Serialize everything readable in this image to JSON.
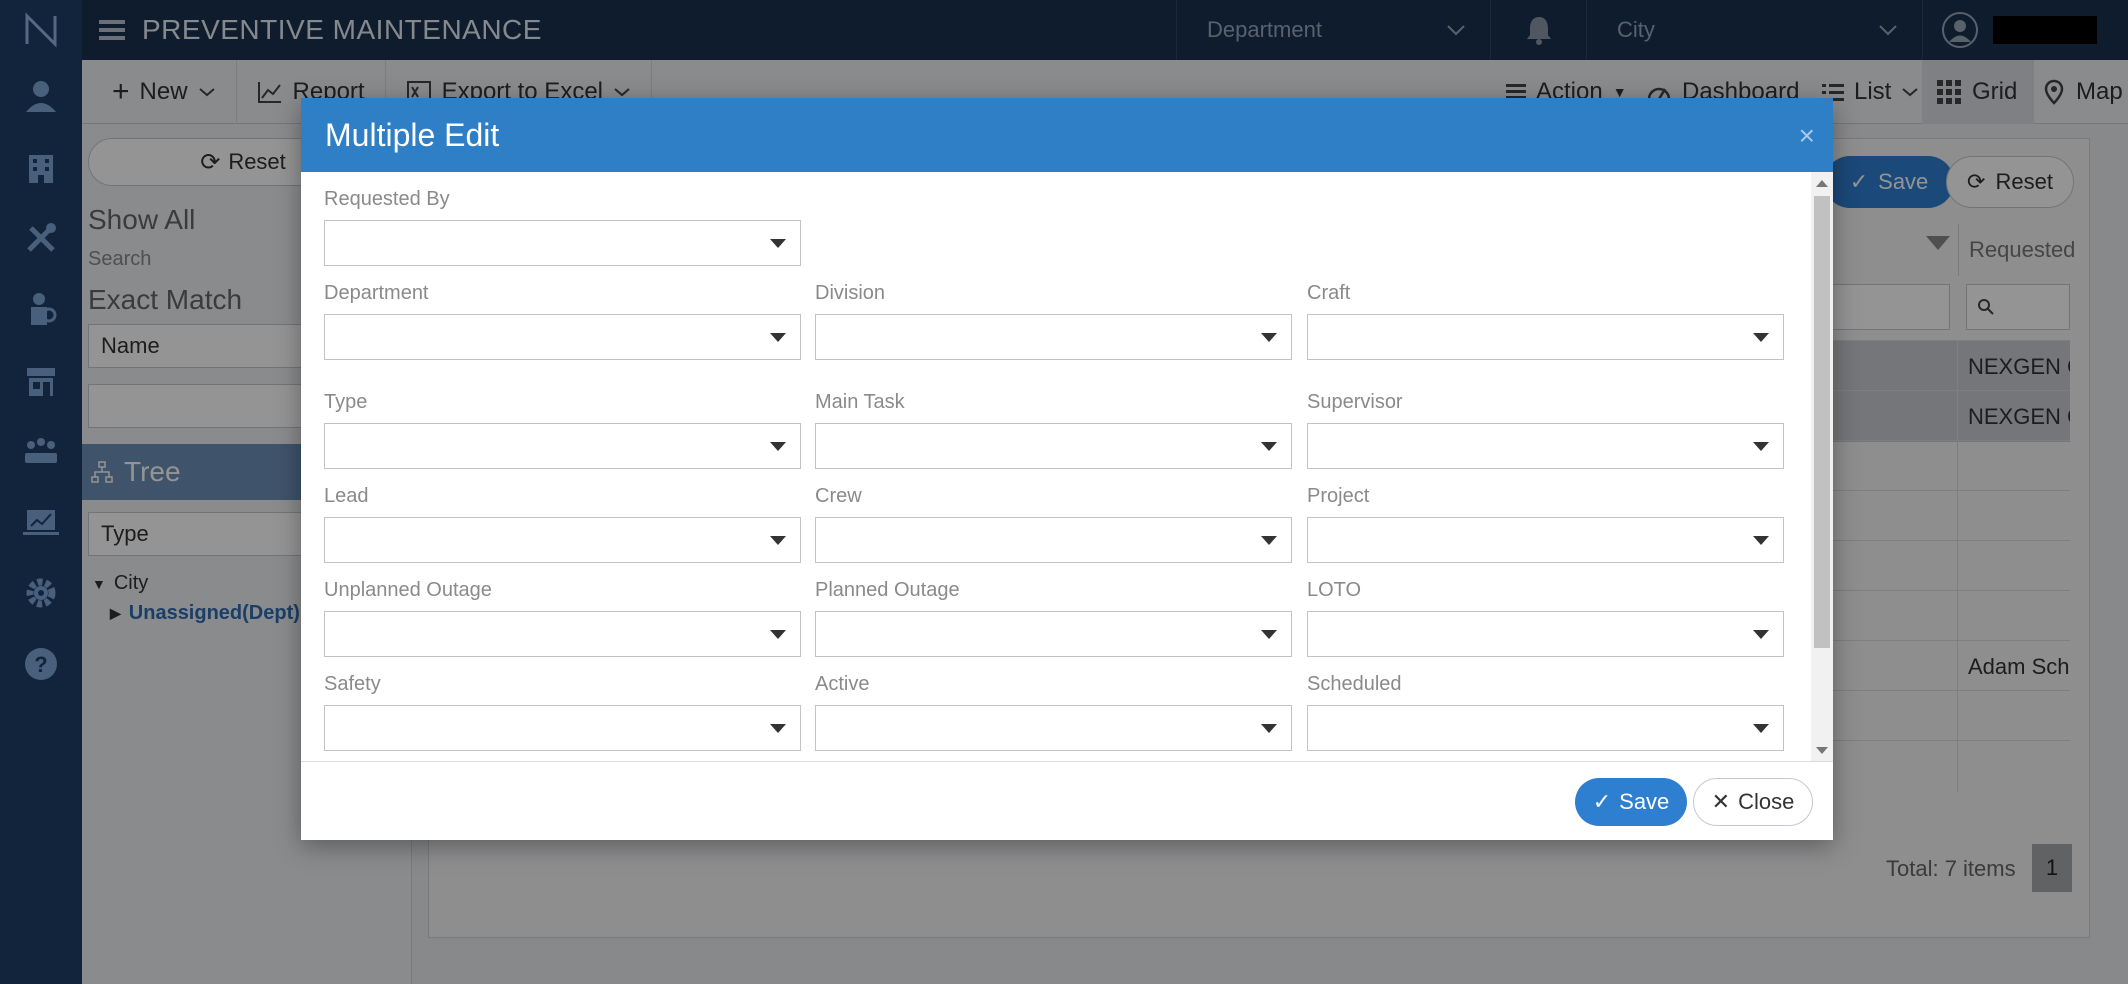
{
  "header": {
    "title": "PREVENTIVE MAINTENANCE",
    "department_placeholder": "Department",
    "city_placeholder": "City"
  },
  "toolbar": {
    "new_label": "New",
    "report_label": "Report",
    "export_label": "Export to Excel",
    "action_label": "Action",
    "dashboard_label": "Dashboard",
    "list_label": "List",
    "grid_label": "Grid",
    "map_label": "Map"
  },
  "filter_panel": {
    "reset_label": "Reset",
    "show_all": "Show All",
    "search_label": "Search",
    "exact_match": "Exact Match",
    "search_field": "Name",
    "tree_label": "Tree",
    "tree_field": "Type",
    "tree_root": "City",
    "tree_child": "Unassigned(Dept)"
  },
  "grid": {
    "save_label": "Save",
    "reset_label": "Reset",
    "column_header": "Requested",
    "rows": [
      "NEXGEN CS",
      "NEXGEN CS",
      "",
      "",
      "",
      "",
      "Adam Schr",
      "",
      ""
    ],
    "total": "Total: 7 items",
    "page": "1"
  },
  "modal": {
    "title": "Multiple Edit",
    "close_symbol": "×",
    "fields": {
      "requested_by": "Requested By",
      "department": "Department",
      "division": "Division",
      "craft": "Craft",
      "type": "Type",
      "main_task": "Main Task",
      "supervisor": "Supervisor",
      "lead": "Lead",
      "crew": "Crew",
      "project": "Project",
      "unplanned_outage": "Unplanned Outage",
      "planned_outage": "Planned Outage",
      "loto": "LOTO",
      "safety": "Safety",
      "active": "Active",
      "scheduled": "Scheduled"
    },
    "save_label": "Save",
    "close_label": "Close"
  },
  "colors": {
    "primary": "#2f7fd1",
    "modal_header": "#2f7fc7",
    "topbar": "#1b3150",
    "rail": "#1f3f66"
  }
}
